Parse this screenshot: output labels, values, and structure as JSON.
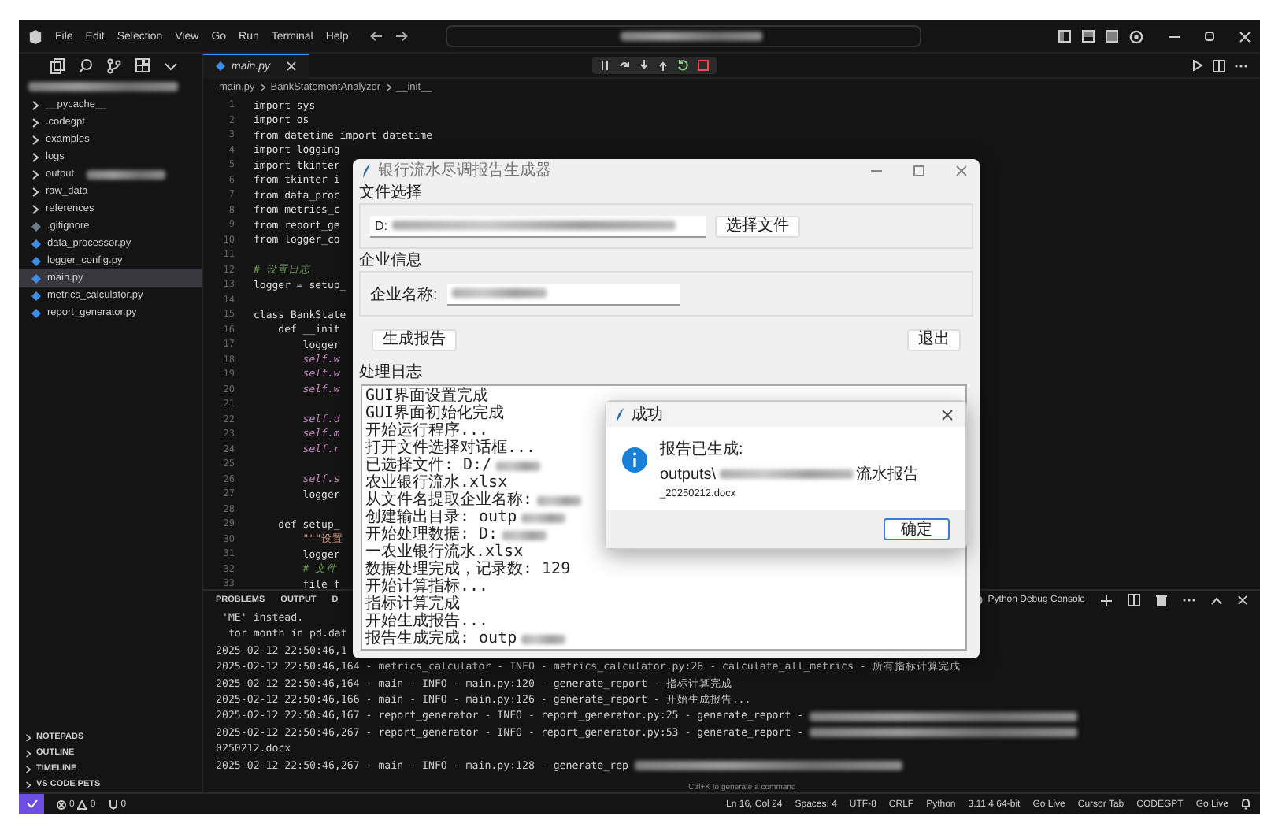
{
  "menu": [
    "File",
    "Edit",
    "Selection",
    "View",
    "Go",
    "Run",
    "Terminal",
    "Help"
  ],
  "sidebar": {
    "items": [
      {
        "label": "__pycache__",
        "kind": "folder",
        "selected": false,
        "redacted": false
      },
      {
        "label": ".codegpt",
        "kind": "folder",
        "selected": false,
        "redacted": false
      },
      {
        "label": "examples",
        "kind": "folder",
        "selected": false,
        "redacted": false
      },
      {
        "label": "logs",
        "kind": "folder",
        "selected": false,
        "redacted": false
      },
      {
        "label": "output",
        "kind": "folder",
        "selected": false,
        "redacted": true
      },
      {
        "label": "raw_data",
        "kind": "folder",
        "selected": false,
        "redacted": false
      },
      {
        "label": "references",
        "kind": "folder",
        "selected": false,
        "redacted": false
      },
      {
        "label": ".gitignore",
        "kind": "file",
        "selected": false,
        "redacted": false
      },
      {
        "label": "data_processor.py",
        "kind": "python",
        "selected": false,
        "redacted": false
      },
      {
        "label": "logger_config.py",
        "kind": "python",
        "selected": false,
        "redacted": false
      },
      {
        "label": "main.py",
        "kind": "python",
        "selected": true,
        "redacted": false
      },
      {
        "label": "metrics_calculator.py",
        "kind": "python",
        "selected": false,
        "redacted": false
      },
      {
        "label": "report_generator.py",
        "kind": "python",
        "selected": false,
        "redacted": false
      }
    ],
    "sections": [
      "NOTEPADS",
      "OUTLINE",
      "TIMELINE",
      "VS CODE PETS"
    ]
  },
  "editor": {
    "tab": "main.py",
    "breadcrumb": [
      "main.py",
      "BankStatementAnalyzer",
      "__init__"
    ],
    "lines": [
      {
        "n": "1",
        "text": "import sys",
        "kind": "code"
      },
      {
        "n": "2",
        "text": "import os",
        "kind": "code"
      },
      {
        "n": "3",
        "text": "from datetime import datetime",
        "kind": "code"
      },
      {
        "n": "4",
        "text": "import logging",
        "kind": "code"
      },
      {
        "n": "5",
        "text": "import tkinter",
        "kind": "code"
      },
      {
        "n": "6",
        "text": "from tkinter i",
        "kind": "code"
      },
      {
        "n": "7",
        "text": "from data_proc",
        "kind": "code"
      },
      {
        "n": "8",
        "text": "from metrics_c",
        "kind": "code"
      },
      {
        "n": "9",
        "text": "from report_ge",
        "kind": "code"
      },
      {
        "n": "10",
        "text": "from logger_co",
        "kind": "code"
      },
      {
        "n": "11"
      },
      {
        "n": "12",
        "text": "# 设置日志",
        "kind": "comment"
      },
      {
        "n": "13",
        "text": "logger = setup_",
        "kind": "code"
      },
      {
        "n": "14"
      },
      {
        "n": "15",
        "text": "class BankState",
        "kind": "code"
      },
      {
        "n": "16",
        "text": "    def __init",
        "kind": "code"
      },
      {
        "n": "17",
        "text": "        logger",
        "kind": "code"
      },
      {
        "n": "18",
        "text": "        self.w",
        "kind": "self"
      },
      {
        "n": "19",
        "text": "        self.w",
        "kind": "self"
      },
      {
        "n": "20",
        "text": "        self.w",
        "kind": "self"
      },
      {
        "n": "21"
      },
      {
        "n": "22",
        "text": "        self.d",
        "kind": "self"
      },
      {
        "n": "23",
        "text": "        self.m",
        "kind": "self"
      },
      {
        "n": "24",
        "text": "        self.r",
        "kind": "self"
      },
      {
        "n": "25"
      },
      {
        "n": "26",
        "text": "        self.s",
        "kind": "self"
      },
      {
        "n": "27",
        "text": "        logger",
        "kind": "code"
      },
      {
        "n": "28"
      },
      {
        "n": "29",
        "text": "    def setup_",
        "kind": "code"
      },
      {
        "n": "30",
        "text": "        \"\"\"设置",
        "kind": "string"
      },
      {
        "n": "31",
        "text": "        logger",
        "kind": "code"
      },
      {
        "n": "32",
        "text": "        # 文件",
        "kind": "comment"
      },
      {
        "n": "33",
        "text": "        file f",
        "kind": "code"
      }
    ]
  },
  "panel": {
    "tabs": [
      "PROBLEMS",
      "OUTPUT",
      "D"
    ],
    "terminal_name": "Python Debug Console",
    "lines": [
      {
        "text": " 'ME' instead.",
        "redacted": false
      },
      {
        "text": "  for month in pd.dat",
        "redacted": false
      },
      {
        "text": "2025-02-12 22:50:46,1",
        "redacted": false
      },
      {
        "text": "2025-02-12 22:50:46,164 - metrics_calculator - INFO - metrics_calculator.py:26 - calculate_all_metrics - 所有指标计算完成",
        "redacted": false
      },
      {
        "text": "2025-02-12 22:50:46,164 - main - INFO - main.py:120 - generate_report - 指标计算完成",
        "redacted": false
      },
      {
        "text": "2025-02-12 22:50:46,166 - main - INFO - main.py:126 - generate_report - 开始生成报告...",
        "redacted": false
      },
      {
        "text": "2025-02-12 22:50:46,167 - report_generator - INFO - report_generator.py:25 - generate_report -",
        "redacted": true
      },
      {
        "text": "2025-02-12 22:50:46,267 - report_generator - INFO - report_generator.py:53 - generate_report -",
        "redacted": true
      },
      {
        "text": "0250212.docx",
        "redacted": false
      },
      {
        "text": "2025-02-12 22:50:46,267 - main - INFO - main.py:128 - generate_rep",
        "redacted": true
      }
    ],
    "hint": "Ctrl+K to generate a command"
  },
  "status_bar": {
    "errors": "0",
    "warnings": "0",
    "ports": "0",
    "right": [
      "Ln 16, Col 24",
      "Spaces: 4",
      "UTF-8",
      "CRLF",
      "Python",
      "3.11.4 64-bit",
      "Go Live",
      "Cursor Tab",
      "CODEGPT",
      "Go Live"
    ]
  },
  "app_window": {
    "title": "银行流水尽调报告生成器",
    "file_group": "文件选择",
    "file_path": "D:",
    "choose_button": "选择文件",
    "company_group": "企业信息",
    "company_label": "企业名称:",
    "generate_button": "生成报告",
    "exit_button": "退出",
    "log_group": "处理日志",
    "log": [
      {
        "text": "GUI界面设置完成",
        "redacted": false
      },
      {
        "text": "GUI界面初始化完成",
        "redacted": false
      },
      {
        "text": "开始运行程序...",
        "redacted": false
      },
      {
        "text": "打开文件选择对话框...",
        "redacted": false
      },
      {
        "text": "已选择文件: D:/",
        "redacted": true
      },
      {
        "text": "农业银行流水.xlsx",
        "redacted": false
      },
      {
        "text": "从文件名提取企业名称:",
        "redacted": true
      },
      {
        "text": "创建输出目录: outp",
        "redacted": true
      },
      {
        "text": "开始处理数据: D:",
        "redacted": true
      },
      {
        "text": "一农业银行流水.xlsx",
        "redacted": false
      },
      {
        "text": "数据处理完成，记录数: 129",
        "redacted": false
      },
      {
        "text": "开始计算指标...",
        "redacted": false
      },
      {
        "text": "指标计算完成",
        "redacted": false
      },
      {
        "text": "开始生成报告...",
        "redacted": false
      },
      {
        "text": "报告生成完成: outp",
        "redacted": true
      }
    ]
  },
  "dialog": {
    "title": "成功",
    "message": "报告已生成:",
    "path_start": "outputs\\",
    "path_end": "流水报告",
    "path_line2": "_20250212.docx",
    "ok_button": "确定"
  }
}
